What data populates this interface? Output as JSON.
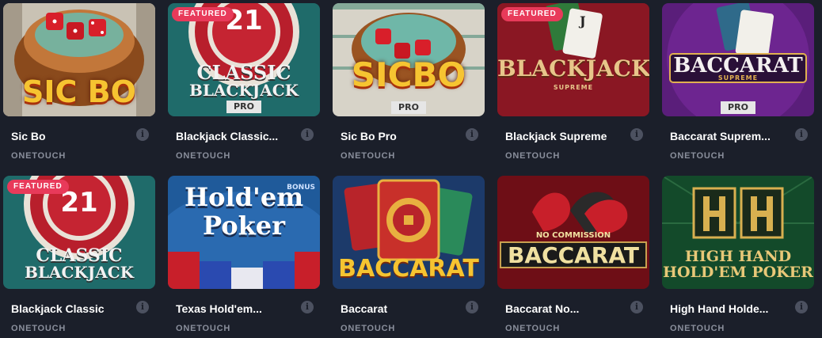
{
  "games": [
    {
      "title": "Sic Bo",
      "provider": "ONETOUCH",
      "badge": "",
      "art": [
        "SIC BO"
      ],
      "art_sub": "",
      "icon": "sic-bo-art"
    },
    {
      "title": "Blackjack Classic...",
      "provider": "ONETOUCH",
      "badge": "FEATURED",
      "art": [
        "CLASSIC",
        "BLACKJACK"
      ],
      "art_sub": "PRO",
      "art_num": "21",
      "icon": "classic-blackjack-pro-art"
    },
    {
      "title": "Sic Bo Pro",
      "provider": "ONETOUCH",
      "badge": "",
      "art": [
        "SICBO"
      ],
      "art_sub": "PRO",
      "icon": "sic-bo-pro-art"
    },
    {
      "title": "Blackjack Supreme",
      "provider": "ONETOUCH",
      "badge": "FEATURED",
      "art": [
        "BLACKJACK"
      ],
      "art_sub": "SUPREME",
      "icon": "blackjack-supreme-art"
    },
    {
      "title": "Baccarat Suprem...",
      "provider": "ONETOUCH",
      "badge": "",
      "art": [
        "BACCARAT"
      ],
      "art_sub": "SUPREME",
      "art_sub2": "PRO",
      "icon": "baccarat-supreme-pro-art"
    },
    {
      "title": "Blackjack Classic",
      "provider": "ONETOUCH",
      "badge": "FEATURED",
      "art": [
        "CLASSIC",
        "BLACKJACK"
      ],
      "art_sub": "",
      "art_num": "21",
      "icon": "classic-blackjack-art"
    },
    {
      "title": "Texas Hold'em...",
      "provider": "ONETOUCH",
      "badge": "",
      "art": [
        "Hold'em",
        "Poker"
      ],
      "art_sub": "BONUS",
      "icon": "texas-holdem-art"
    },
    {
      "title": "Baccarat",
      "provider": "ONETOUCH",
      "badge": "",
      "art": [
        "BACCARAT"
      ],
      "art_sub": "",
      "icon": "baccarat-art"
    },
    {
      "title": "Baccarat No...",
      "provider": "ONETOUCH",
      "badge": "",
      "art": [
        "BACCARAT"
      ],
      "art_sub": "NO COMMISSION",
      "icon": "baccarat-no-commission-art"
    },
    {
      "title": "High Hand Holde...",
      "provider": "ONETOUCH",
      "badge": "",
      "art": [
        "HIGH HAND",
        "HOLD'EM POKER"
      ],
      "art_sub": "",
      "icon": "high-hand-holdem-art"
    }
  ],
  "colors": {
    "background": "#1b1f2a",
    "badge": "#e83a5a",
    "provider_text": "#8a8f9c",
    "info_icon": "#4c5160"
  }
}
